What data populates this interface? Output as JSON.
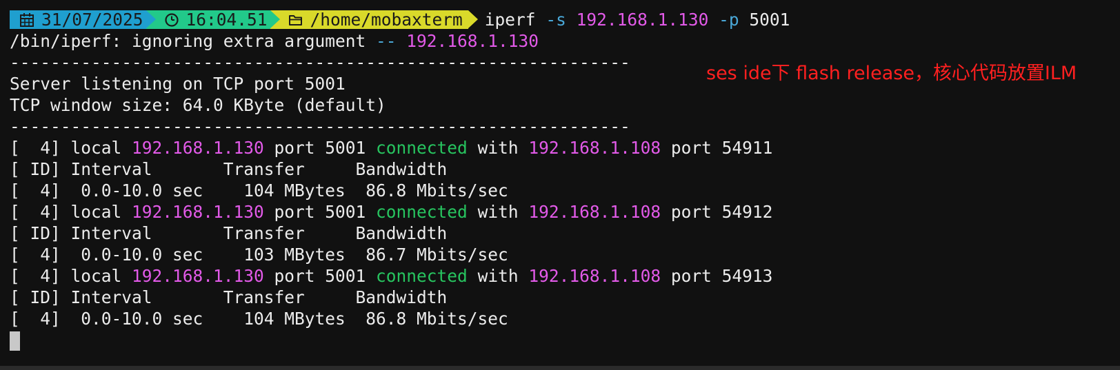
{
  "prompt": {
    "date": "31/07/2025",
    "time": "16:04.51",
    "path": "/home/mobaxterm",
    "colors": {
      "date_bg": "#1f9fcf",
      "time_bg": "#22c98a",
      "path_bg": "#d9d92a"
    },
    "icons": [
      "calendar-icon",
      "clock-icon",
      "folder-icon"
    ]
  },
  "command": {
    "name": "iperf",
    "flag1": "-s",
    "ip": "192.168.1.130",
    "flag2": "-p",
    "port": "5001"
  },
  "warning": {
    "text": "/bin/iperf: ignoring extra argument ",
    "dashes": "--",
    "ip": "192.168.1.130"
  },
  "separator": "-------------------------------------------------------------",
  "server_info": {
    "listening": "Server listening on TCP port 5001",
    "window": "TCP window size: 64.0 KByte (default)"
  },
  "sessions": [
    {
      "pre": "[  4] local ",
      "local_ip": "192.168.1.130",
      "mid": " port 5001 ",
      "status": "connected",
      "with": " with ",
      "remote_ip": "192.168.1.108",
      "post": " port 54911",
      "header": "[ ID] Interval       Transfer     Bandwidth",
      "result": "[  4]  0.0-10.0 sec    104 MBytes  86.8 Mbits/sec"
    },
    {
      "pre": "[  4] local ",
      "local_ip": "192.168.1.130",
      "mid": " port 5001 ",
      "status": "connected",
      "with": " with ",
      "remote_ip": "192.168.1.108",
      "post": " port 54912",
      "header": "[ ID] Interval       Transfer     Bandwidth",
      "result": "[  4]  0.0-10.0 sec    103 MBytes  86.7 Mbits/sec"
    },
    {
      "pre": "[  4] local ",
      "local_ip": "192.168.1.130",
      "mid": " port 5001 ",
      "status": "connected",
      "with": " with ",
      "remote_ip": "192.168.1.108",
      "post": " port 54913",
      "header": "[ ID] Interval       Transfer     Bandwidth",
      "result": "[  4]  0.0-10.0 sec    104 MBytes  86.8 Mbits/sec"
    }
  ],
  "annotation": "ses ide下 flash release，核心代码放置ILM",
  "colors": {
    "background": "#111111",
    "ip": "#e25ae8",
    "flag": "#4aa8d8",
    "connected": "#27c45f",
    "annotation": "#ff2020"
  }
}
